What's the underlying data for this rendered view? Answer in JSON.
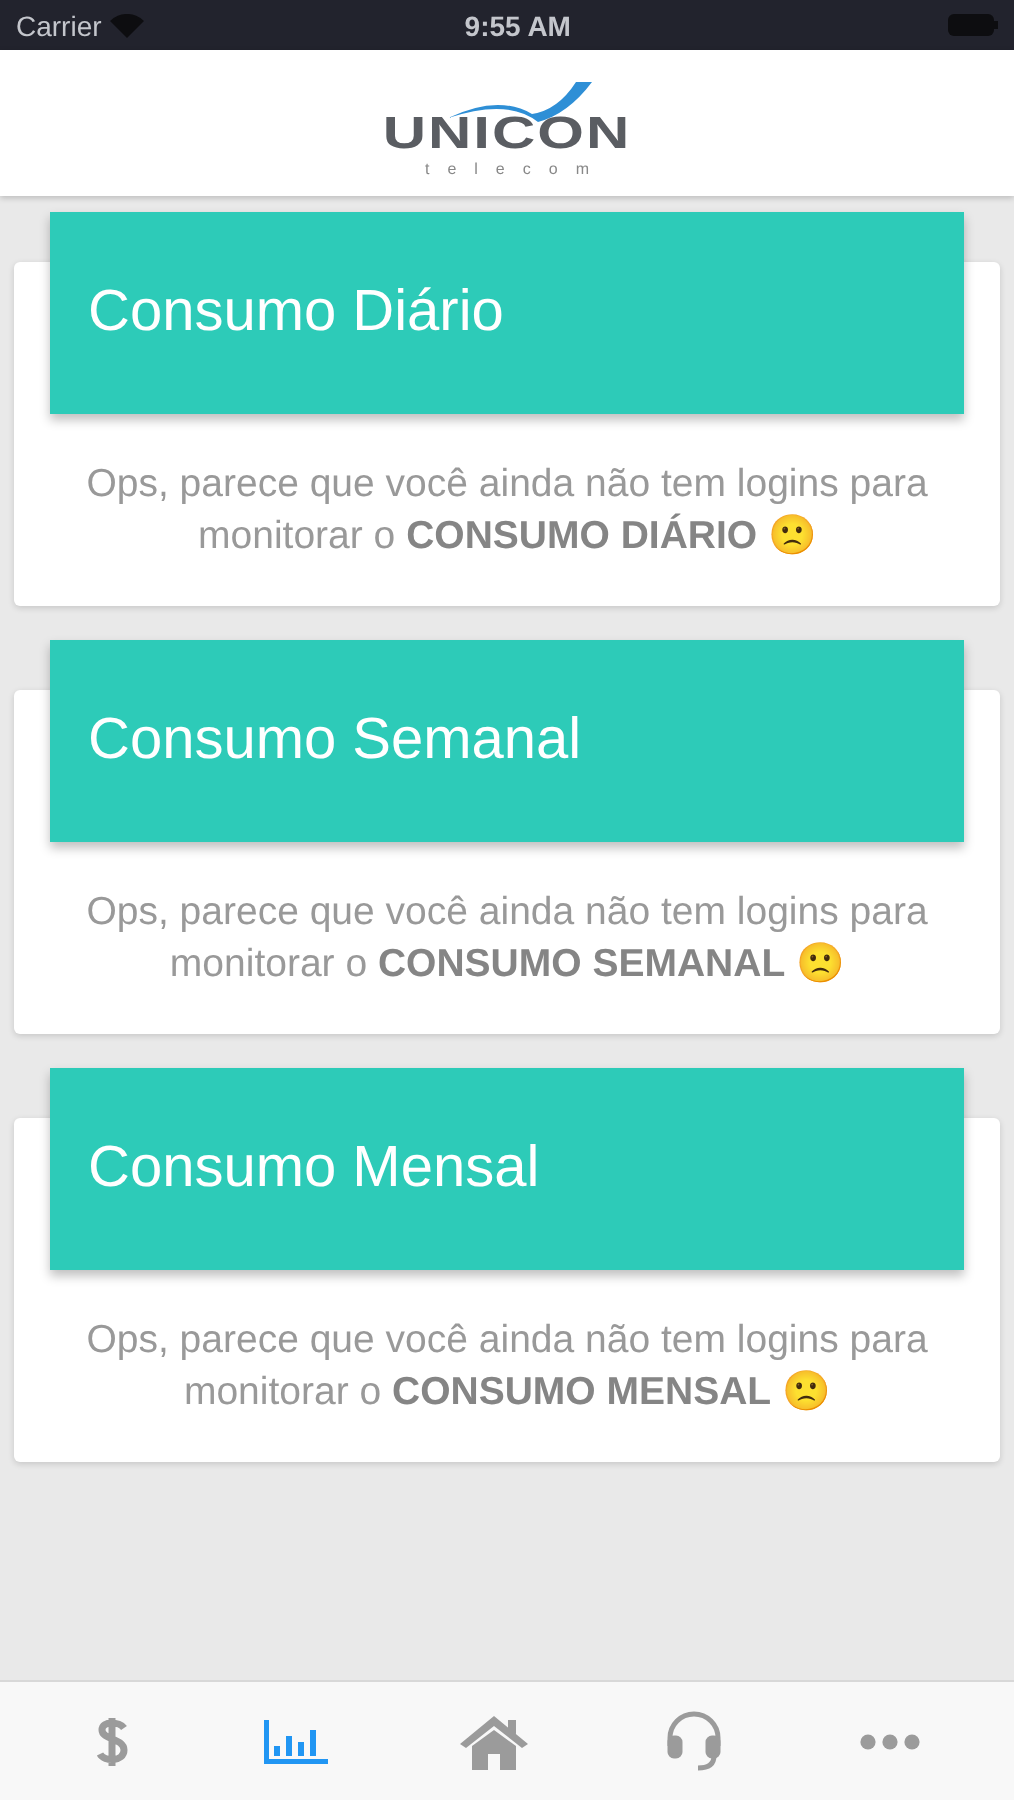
{
  "status_bar": {
    "carrier": "Carrier",
    "time": "9:55 AM"
  },
  "header": {
    "logo_name": "UNICON",
    "logo_tagline": "telecom"
  },
  "cards": [
    {
      "title": "Consumo Diário",
      "message": "Ops, parece que você ainda não tem logins para monitorar o **CONSUMO DIÁRIO** 🙁"
    },
    {
      "title": "Consumo Semanal",
      "message": "Ops, parece que você ainda não tem logins para monitorar o **CONSUMO SEMANAL** 🙁"
    },
    {
      "title": "Consumo Mensal",
      "message": "Ops, parece que você ainda não tem logins para monitorar o **CONSUMO MENSAL** 🙁"
    }
  ],
  "tab_bar": [
    {
      "kind": "dollar",
      "selected": false
    },
    {
      "kind": "chart",
      "selected": true
    },
    {
      "kind": "home",
      "selected": false
    },
    {
      "kind": "support",
      "selected": false
    },
    {
      "kind": "more",
      "selected": false
    }
  ]
}
